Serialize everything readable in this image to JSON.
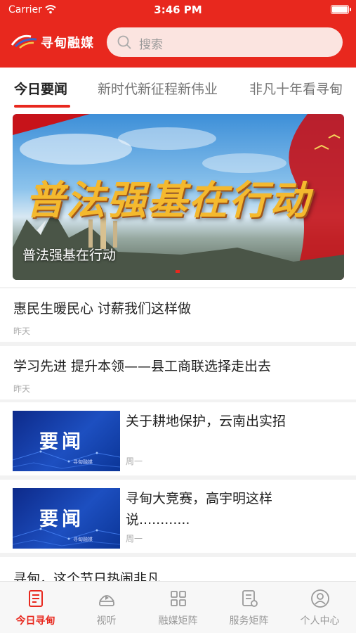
{
  "status_bar": {
    "carrier": "Carrier",
    "time": "3:46 PM"
  },
  "header": {
    "logo_text": "寻甸融媒",
    "search": {
      "placeholder": "搜索",
      "icon": "search-icon"
    }
  },
  "tabs": [
    {
      "label": "今日要闻",
      "active": true
    },
    {
      "label": "新时代新征程新伟业",
      "active": false
    },
    {
      "label": "非凡十年看寻甸",
      "active": false
    }
  ],
  "banner": {
    "image_text": "普法强基在行动",
    "caption": "普法强基在行动"
  },
  "news": [
    {
      "title": "惠民生暖民心 讨薪我们这样做",
      "time": "昨天"
    },
    {
      "title": "学习先进 提升本领——县工商联选择走出去",
      "time": "昨天"
    },
    {
      "title": "关于耕地保护，云南出实招",
      "time": "周一",
      "thumb_text": "要闻",
      "thumb_logo": "寻甸融媒"
    },
    {
      "title": "寻甸大竞赛，高宇明这样说............",
      "time": "周一",
      "thumb_text": "要闻",
      "thumb_logo": "寻甸融媒"
    },
    {
      "title": "寻甸，这个节日热闹非凡"
    }
  ],
  "tabbar": [
    {
      "label": "今日寻甸",
      "icon": "news-icon",
      "active": true
    },
    {
      "label": "视听",
      "icon": "video-icon",
      "active": false
    },
    {
      "label": "融媒矩阵",
      "icon": "matrix-icon",
      "active": false
    },
    {
      "label": "服务矩阵",
      "icon": "service-icon",
      "active": false
    },
    {
      "label": "个人中心",
      "icon": "profile-icon",
      "active": false
    }
  ],
  "colors": {
    "brand_red": "#e8281e",
    "thumb_blue": "#1d4fc0"
  }
}
